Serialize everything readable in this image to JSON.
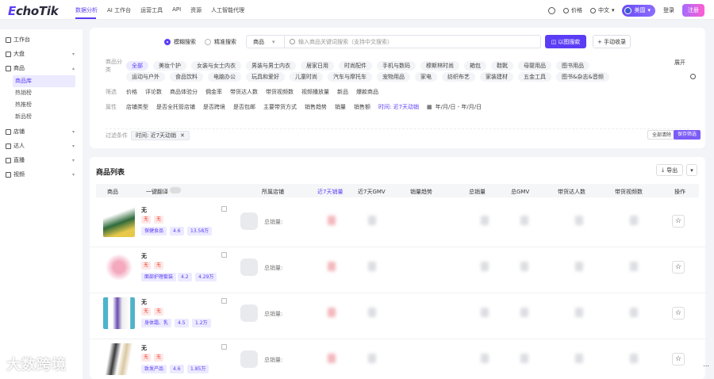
{
  "brand": {
    "logo": "EchoTik"
  },
  "nav": {
    "items": [
      "数据分析",
      "AI 工作台",
      "运营工具",
      "API",
      "资源",
      "人工智能代理"
    ]
  },
  "topright": {
    "price": "价格",
    "lang": "中文",
    "country": "美国",
    "login": "登录",
    "register": "注册"
  },
  "sidebar": {
    "workbench": "工作台",
    "market": "大盘",
    "product": "商品",
    "sub": [
      "商品库",
      "热销榜",
      "热推榜",
      "新品榜"
    ],
    "shop": "店铺",
    "creator": "达人",
    "live": "直播",
    "video": "视频"
  },
  "search": {
    "mode_fuzzy": "模糊搜索",
    "mode_exact": "精准搜索",
    "category": "商品",
    "placeholder": "输入商品关键词搜索（支持中文搜索）",
    "image_search": "以图搜款",
    "manual": "+ 手动收录"
  },
  "filters": {
    "cat_label": "商品分类",
    "row1": [
      "全部",
      "美妆个护",
      "女装与女士内衣",
      "男装与男士内衣",
      "居家日用",
      "时尚配件",
      "手机与数码",
      "穆斯林时尚",
      "箱包",
      "鞋靴",
      "母婴用品",
      "图书用品"
    ],
    "expand": "展开",
    "row2": [
      "运动与户外",
      "食品饮料",
      "电脑办公",
      "玩具和爱好",
      "儿童时尚",
      "汽车与摩托车",
      "宠物用品",
      "家电",
      "纺织布艺",
      "家装建材",
      "五金工具",
      "图书&杂志&音频"
    ],
    "screen_label": "筛选",
    "row3": [
      "价格",
      "评论数",
      "商品体验分",
      "佣金率",
      "带货达人数",
      "带货视频数",
      "视频播放量",
      "新品",
      "爆款商品"
    ],
    "attr_label": "属性",
    "row4": [
      "店铺类型",
      "是否全托管店铺",
      "是否跨境",
      "是否包邮",
      "主要带货方式",
      "销售趋势",
      "销量",
      "销售额",
      "时间: 近7天动销"
    ],
    "date_range": "年/月/日 - 年/月/日",
    "cond_label": "过滤条件",
    "cond_tag": "时间: 近7天动销",
    "clear_all": "全部清除",
    "save": "保存筛选"
  },
  "list": {
    "title": "商品列表",
    "export": "导出",
    "headers": [
      "商品",
      "一键翻译",
      "所属店铺",
      "近7天销量",
      "近7天GMV",
      "销量趋势",
      "总销量",
      "总GMV",
      "带货达人数",
      "带货视频数",
      "操作"
    ],
    "shop_label": "总销量:",
    "rows": [
      {
        "name": "无",
        "b1": "无",
        "b2": "无",
        "cat": "保健食品",
        "score": "4.6",
        "sold": "13.58万"
      },
      {
        "name": "无",
        "b1": "无",
        "b2": "无",
        "cat": "面部护理套装",
        "score": "4.2",
        "sold": "4.29万"
      },
      {
        "name": "无",
        "b1": "无",
        "b2": "无",
        "cat": "身体霜、乳",
        "score": "4.5",
        "sold": "1.2万"
      },
      {
        "name": "无",
        "b1": "无",
        "b2": "无",
        "cat": "致发产品",
        "score": "4.6",
        "sold": "1.85万"
      }
    ]
  },
  "watermark": "大数跨境",
  "colors": {
    "accent": "#5b3df5"
  }
}
